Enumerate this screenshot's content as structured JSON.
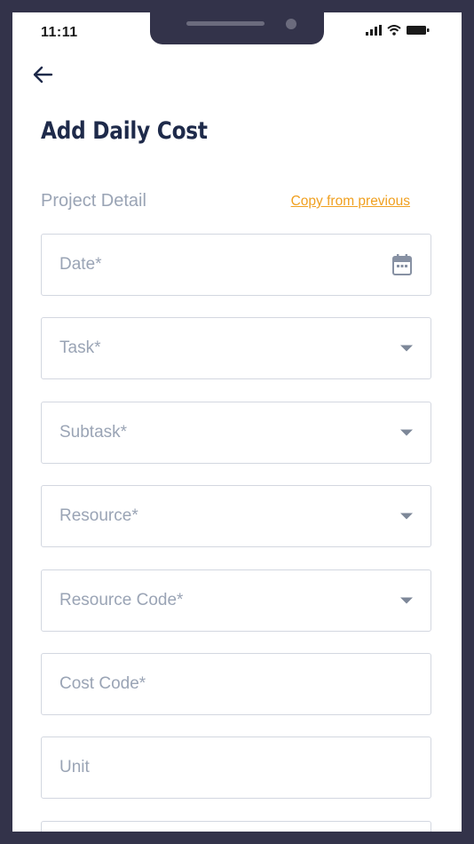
{
  "status_bar": {
    "time": "11:11"
  },
  "header": {
    "title": "Add Daily Cost"
  },
  "section": {
    "label": "Project Detail",
    "copy_link": "Copy from previous"
  },
  "fields": {
    "date": {
      "placeholder": "Date*",
      "icon": "calendar-icon"
    },
    "task": {
      "placeholder": "Task*",
      "icon": "chevron-down-icon"
    },
    "subtask": {
      "placeholder": "Subtask*",
      "icon": "chevron-down-icon"
    },
    "resource": {
      "placeholder": "Resource*",
      "icon": "chevron-down-icon"
    },
    "resource_code": {
      "placeholder": "Resource Code*",
      "icon": "chevron-down-icon"
    },
    "cost_code": {
      "placeholder": "Cost Code*"
    },
    "unit": {
      "placeholder": "Unit"
    }
  },
  "colors": {
    "title": "#1e2a4a",
    "placeholder": "#9aa4b5",
    "link": "#f0a020",
    "border": "#d3d7e0",
    "frame": "#33334a"
  }
}
